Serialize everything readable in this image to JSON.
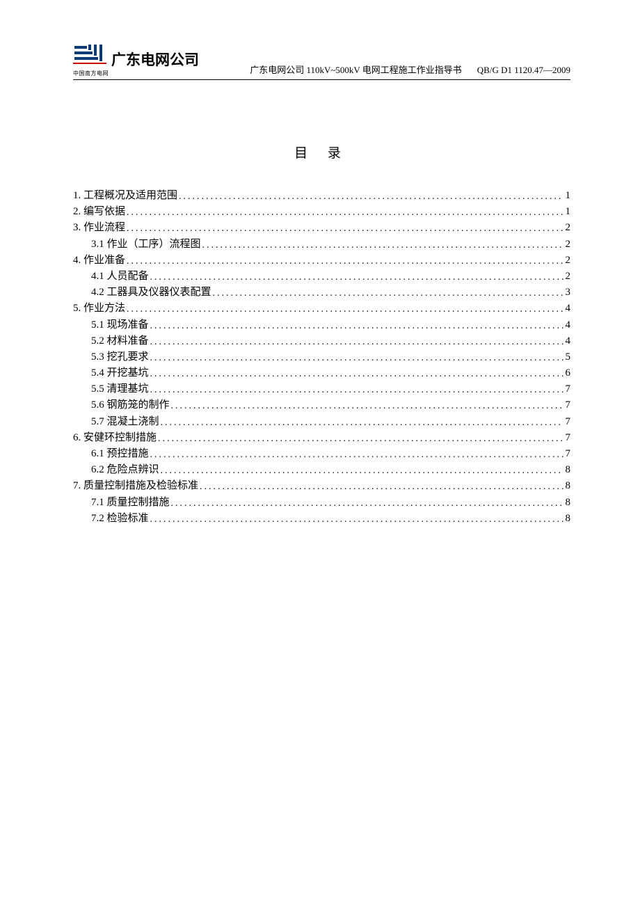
{
  "header": {
    "company_name": "广东电网公司",
    "logo_sub": "中国南方电网",
    "doc_title": "广东电网公司 110kV~500kV 电网工程施工作业指导书",
    "doc_code": "QB/G D1 1120.47—2009"
  },
  "toc_title": "目 录",
  "toc": [
    {
      "level": 0,
      "num": "1.",
      "label": "工程概况及适用范围",
      "page": "1"
    },
    {
      "level": 0,
      "num": "2.",
      "label": "编写依据",
      "page": "1"
    },
    {
      "level": 0,
      "num": "3.",
      "label": "作业流程",
      "page": "2"
    },
    {
      "level": 1,
      "num": "3.1",
      "label": " 作业（工序）流程图",
      "page": "2"
    },
    {
      "level": 0,
      "num": "4.",
      "label": "作业准备",
      "page": "2"
    },
    {
      "level": 1,
      "num": "4.1",
      "label": "  人员配备",
      "page": "2"
    },
    {
      "level": 1,
      "num": "4.2",
      "label": "  工器具及仪器仪表配置",
      "page": "3"
    },
    {
      "level": 0,
      "num": "5.",
      "label": "作业方法",
      "page": "4"
    },
    {
      "level": 1,
      "num": "5.1",
      "label": "  现场准备",
      "page": "4"
    },
    {
      "level": 1,
      "num": "5.2",
      "label": " 材料准备",
      "page": "4"
    },
    {
      "level": 1,
      "num": "5.3",
      "label": " 挖孔要求",
      "page": "5"
    },
    {
      "level": 1,
      "num": "5.4",
      "label": " 开挖基坑",
      "page": "6"
    },
    {
      "level": 1,
      "num": "5.5",
      "label": " 清理基坑",
      "page": "7"
    },
    {
      "level": 1,
      "num": "5.6",
      "label": " 钢筋笼的制作",
      "page": "7"
    },
    {
      "level": 1,
      "num": "5.7",
      "label": " 混凝土浇制 ",
      "page": "7"
    },
    {
      "level": 0,
      "num": "6.",
      "label": "安健环控制措施",
      "page": "7"
    },
    {
      "level": 1,
      "num": "6.1",
      "label": " 预控措施 ",
      "page": "7"
    },
    {
      "level": 1,
      "num": "6.2",
      "label": " 危险点辨识",
      "page": "8"
    },
    {
      "level": 0,
      "num": "7.",
      "label": "质量控制措施及检验标准",
      "page": "8"
    },
    {
      "level": 1,
      "num": "7.1",
      "label": " 质量控制措施",
      "page": "8"
    },
    {
      "level": 1,
      "num": "7.2",
      "label": " 检验标准",
      "page": "8"
    }
  ]
}
